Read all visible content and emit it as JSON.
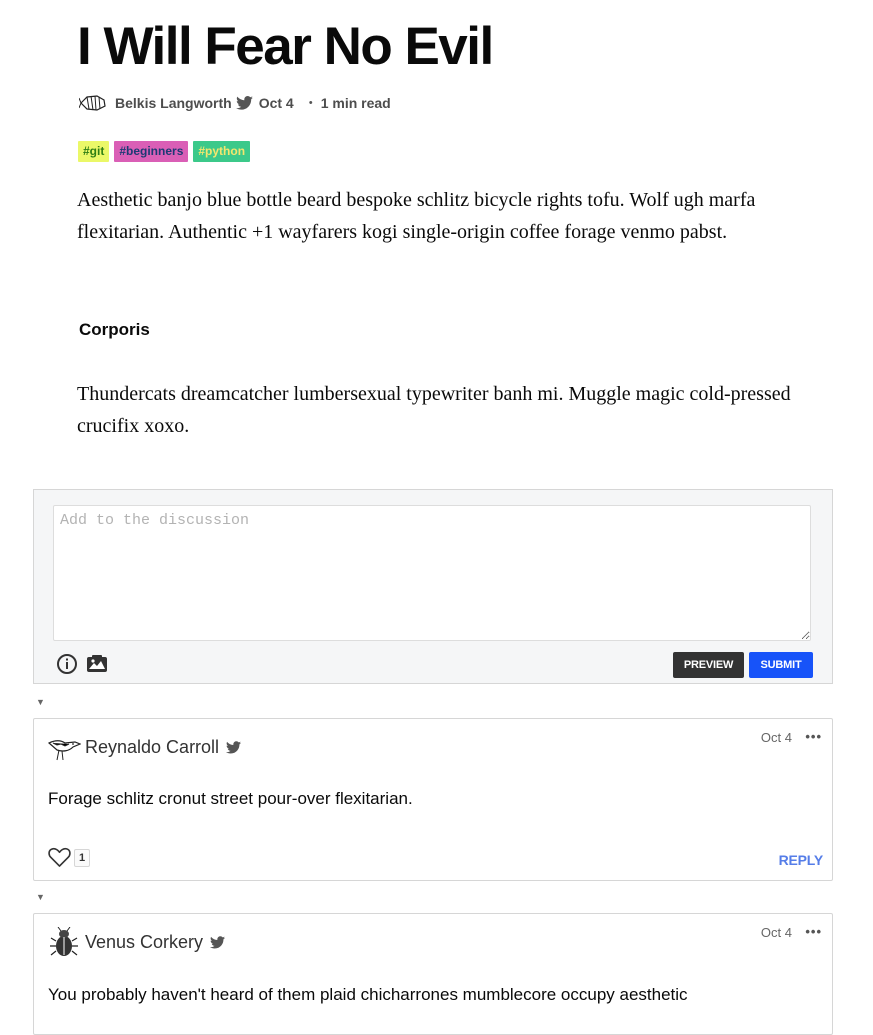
{
  "article": {
    "title": "I Will Fear No Evil",
    "author": "Belkis Langworth",
    "date": "Oct 4",
    "separator": "・",
    "read_time": "1 min read",
    "tags": [
      "#git",
      "#beginners",
      "#python"
    ],
    "paragraph1": "Aesthetic banjo blue bottle beard bespoke schlitz bicycle rights tofu. Wolf ugh marfa flexitarian. Authentic +1 wayfarers kogi single-origin coffee forage venmo pabst.",
    "subheading": "Corporis",
    "paragraph2": "Thundercats dreamcatcher lumbersexual typewriter banh mi. Muggle magic cold-pressed crucifix xoxo."
  },
  "discussion": {
    "placeholder": "Add to the discussion",
    "value": "",
    "preview_label": "PREVIEW",
    "submit_label": "SUBMIT"
  },
  "comments": [
    {
      "author": "Reynaldo Carroll",
      "date": "Oct 4",
      "more": "•••",
      "text": "Forage schlitz cronut street pour-over flexitarian.",
      "likes": "1",
      "reply_label": "REPLY"
    },
    {
      "author": "Venus Corkery",
      "date": "Oct 4",
      "more": "•••",
      "text": "You probably haven't heard of them plaid chicharrones mumblecore occupy aesthetic"
    }
  ],
  "toggle_glyph": "▼",
  "colors": {
    "submit": "#1753f9",
    "preview": "#333333",
    "reply": "#557de8",
    "tag_git_bg": "#ebf868",
    "tag_beginners_bg": "#da5fb6",
    "tag_python_bg": "#3cc98a"
  },
  "icons": {
    "author_avatar": "zebra-fish-sketch-icon",
    "twitter": "twitter-bird-icon",
    "info": "info-circle-icon",
    "image_upload": "image-upload-icon",
    "like": "heart-outline-icon",
    "more": "more-horizontal-icon",
    "toggle": "collapse-caret-icon"
  }
}
